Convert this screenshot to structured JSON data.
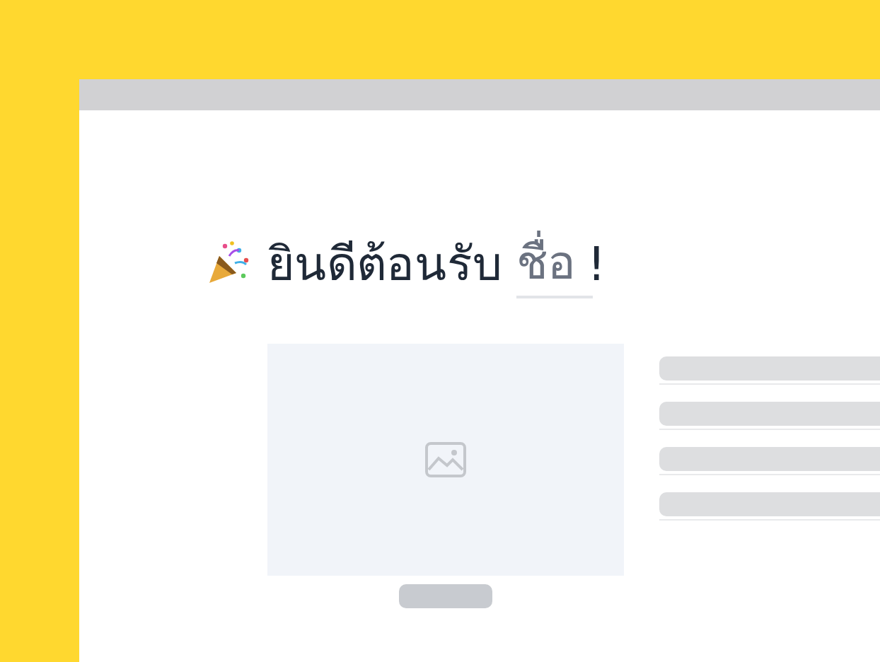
{
  "heading": {
    "greeting": "ยินดีต้อนรับ",
    "name_field": {
      "placeholder": "ชื่อ"
    },
    "punctuation": "!"
  }
}
